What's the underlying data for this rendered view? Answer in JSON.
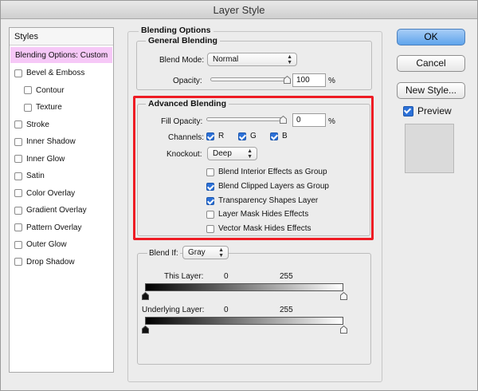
{
  "window": {
    "title": "Layer Style"
  },
  "styles_panel": {
    "header": "Styles",
    "items": [
      {
        "label": "Blending Options: Custom",
        "selected": true,
        "has_checkbox": false,
        "indent": false,
        "checked": false
      },
      {
        "label": "Bevel & Emboss",
        "has_checkbox": true,
        "indent": false,
        "checked": false
      },
      {
        "label": "Contour",
        "has_checkbox": true,
        "indent": true,
        "checked": false
      },
      {
        "label": "Texture",
        "has_checkbox": true,
        "indent": true,
        "checked": false
      },
      {
        "label": "Stroke",
        "has_checkbox": true,
        "indent": false,
        "checked": false
      },
      {
        "label": "Inner Shadow",
        "has_checkbox": true,
        "indent": false,
        "checked": false
      },
      {
        "label": "Inner Glow",
        "has_checkbox": true,
        "indent": false,
        "checked": false
      },
      {
        "label": "Satin",
        "has_checkbox": true,
        "indent": false,
        "checked": false
      },
      {
        "label": "Color Overlay",
        "has_checkbox": true,
        "indent": false,
        "checked": false
      },
      {
        "label": "Gradient Overlay",
        "has_checkbox": true,
        "indent": false,
        "checked": false
      },
      {
        "label": "Pattern Overlay",
        "has_checkbox": true,
        "indent": false,
        "checked": false
      },
      {
        "label": "Outer Glow",
        "has_checkbox": true,
        "indent": false,
        "checked": false
      },
      {
        "label": "Drop Shadow",
        "has_checkbox": true,
        "indent": false,
        "checked": false
      }
    ]
  },
  "blending_options": {
    "title": "Blending Options",
    "general": {
      "title": "General Blending",
      "blend_mode_label": "Blend Mode:",
      "blend_mode_value": "Normal",
      "opacity_label": "Opacity:",
      "opacity_value": "100",
      "opacity_unit": "%",
      "opacity_fraction": 1.0
    },
    "advanced": {
      "title": "Advanced Blending",
      "fill_opacity_label": "Fill Opacity:",
      "fill_opacity_value": "0",
      "fill_opacity_unit": "%",
      "fill_opacity_fraction": 0.0,
      "channels_label": "Channels:",
      "channels": [
        {
          "label": "R",
          "checked": true
        },
        {
          "label": "G",
          "checked": true
        },
        {
          "label": "B",
          "checked": true
        }
      ],
      "knockout_label": "Knockout:",
      "knockout_value": "Deep",
      "options": [
        {
          "label": "Blend Interior Effects as Group",
          "checked": false
        },
        {
          "label": "Blend Clipped Layers as Group",
          "checked": true
        },
        {
          "label": "Transparency Shapes Layer",
          "checked": true
        },
        {
          "label": "Layer Mask Hides Effects",
          "checked": false
        },
        {
          "label": "Vector Mask Hides Effects",
          "checked": false
        }
      ]
    },
    "blend_if": {
      "label": "Blend If:",
      "value": "Gray",
      "this_layer_label": "This Layer:",
      "this_layer_min": "0",
      "this_layer_max": "255",
      "underlying_label": "Underlying Layer:",
      "underlying_min": "0",
      "underlying_max": "255"
    }
  },
  "buttons": {
    "ok": "OK",
    "cancel": "Cancel",
    "new_style": "New Style...",
    "preview_label": "Preview",
    "preview_checked": true
  },
  "colors": {
    "selected_style": "#f6c8f7",
    "highlight_frame": "#ee1c24",
    "checkbox_checked": "#2c71d8",
    "default_button": "#5fa4ec"
  }
}
